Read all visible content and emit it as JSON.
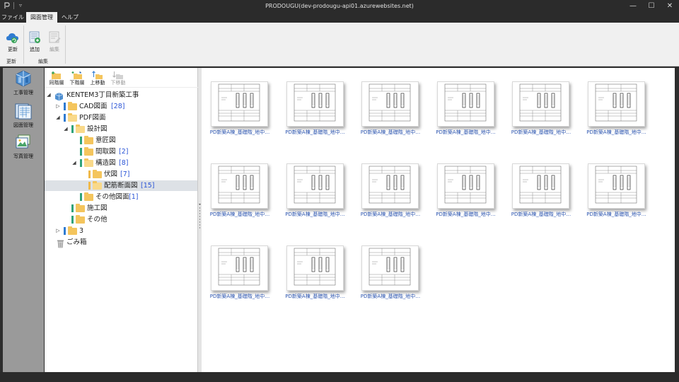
{
  "window": {
    "title": "PRODOUGU(dev-prodougu-api01.azurewebsites.net)",
    "minimize_glyph": "—",
    "maximize_glyph": "☐",
    "close_glyph": "✕",
    "quick_access_glyph": "▿"
  },
  "ribbon_tabs": [
    {
      "label": "ファイル"
    },
    {
      "label": "図面管理"
    },
    {
      "label": "ヘルプ"
    }
  ],
  "ribbon": {
    "refresh_label": "更新",
    "add_label": "追加",
    "edit_label": "編集",
    "group_refresh": "更新",
    "group_edit": "編集"
  },
  "nav": {
    "items": [
      {
        "label": "工事管理",
        "icon": "construction-management-icon"
      },
      {
        "label": "図面管理",
        "icon": "drawing-management-icon"
      },
      {
        "label": "写真管理",
        "icon": "photo-management-icon"
      }
    ]
  },
  "tree_toolbar": {
    "same_level": "同階層",
    "lower_level": "下階層",
    "move_up": "上移動",
    "move_down": "下移動"
  },
  "tree": [
    {
      "label": "KENTEM3丁目新築工事",
      "count": ""
    },
    {
      "label": "CAD図面",
      "count": "[28]"
    },
    {
      "label": "PDF図面",
      "count": ""
    },
    {
      "label": "設計図",
      "count": ""
    },
    {
      "label": "意匠図",
      "count": ""
    },
    {
      "label": "間取図",
      "count": "[2]"
    },
    {
      "label": "構造図",
      "count": "[8]"
    },
    {
      "label": "伏図",
      "count": "[7]"
    },
    {
      "label": "配筋断面図",
      "count": "[15]"
    },
    {
      "label": "その他図面",
      "count": "[1]"
    },
    {
      "label": "施工図",
      "count": ""
    },
    {
      "label": "その他",
      "count": ""
    },
    {
      "label": "3",
      "count": ""
    },
    {
      "label": "ごみ箱",
      "count": ""
    }
  ],
  "thumbnails": [
    {
      "label": "PD新築A棟_基礎階_地中…"
    },
    {
      "label": "PD新築A棟_基礎階_地中…"
    },
    {
      "label": "PD新築A棟_基礎階_地中…"
    },
    {
      "label": "PD新築A棟_基礎階_地中…"
    },
    {
      "label": "PD新築A棟_基礎階_地中…"
    },
    {
      "label": "PD新築A棟_基礎階_地中…"
    },
    {
      "label": "PD新築A棟_基礎階_地中…"
    },
    {
      "label": "PD新築A棟_基礎階_地中…"
    },
    {
      "label": "PD新築A棟_基礎階_地中…"
    },
    {
      "label": "PD新築A棟_基礎階_地中…"
    },
    {
      "label": "PD新築A棟_基礎階_地中…"
    },
    {
      "label": "PD新築A棟_基礎階_地中…"
    },
    {
      "label": "PD新築A棟_基礎階_地中…"
    },
    {
      "label": "PD新築A棟_基礎階_地中…"
    },
    {
      "label": "PD新築A棟_基礎階_地中…"
    }
  ]
}
